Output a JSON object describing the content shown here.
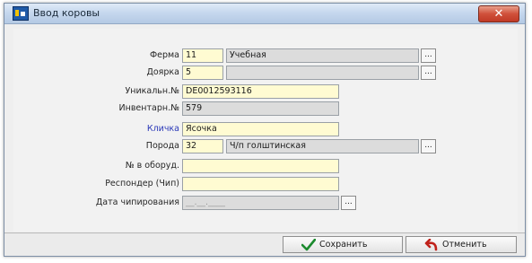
{
  "window": {
    "title": "Ввод коровы",
    "close_label": "✕"
  },
  "fields": {
    "farm": {
      "label": "Ферма",
      "code": "11",
      "name": "Учебная",
      "button": "..."
    },
    "milking": {
      "label": "Доярка",
      "code": "5",
      "name": "",
      "button": "..."
    },
    "unique_no": {
      "label": "Уникальн.№",
      "value": "DE0012593116"
    },
    "inventory_no": {
      "label": "Инвентарн.№",
      "value": "579"
    },
    "nickname": {
      "label": "Кличка",
      "value": "Ясочка"
    },
    "breed": {
      "label": "Порода",
      "code": "32",
      "name": "Ч/п голштинская",
      "button": "..."
    },
    "equipment_no": {
      "label": "№ в оборуд.",
      "value": ""
    },
    "responder": {
      "label": "Респондер (Чип)",
      "value": ""
    },
    "chip_date": {
      "label": "Дата чипирования",
      "value": "__.__.____",
      "button": "..."
    }
  },
  "buttons": {
    "save": "Сохранить",
    "cancel": "Отменить"
  },
  "colors": {
    "required_field_bg": "#fffbd2",
    "readonly_field_bg": "#dcdcdc",
    "nickname_label": "#2b39b8",
    "save_icon": "#1b8a2e",
    "cancel_icon": "#c0221b"
  }
}
